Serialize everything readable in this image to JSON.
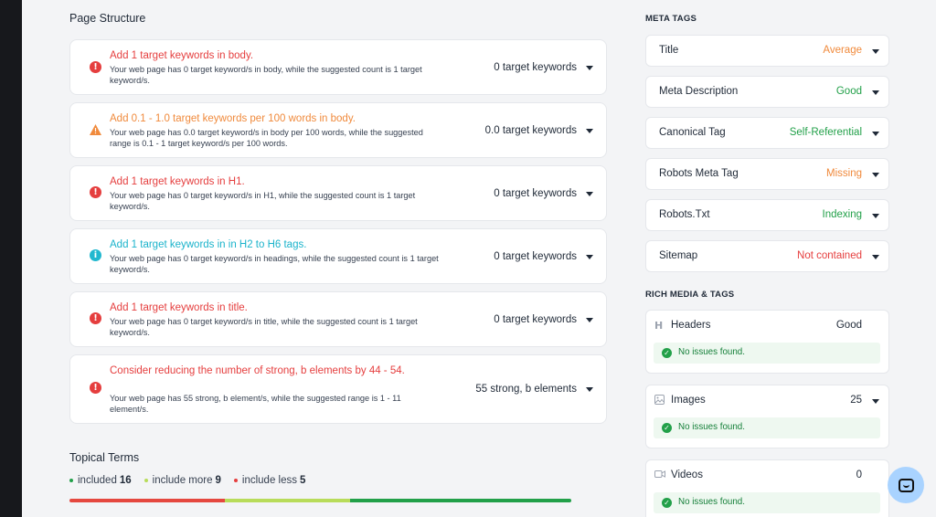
{
  "page_structure": {
    "heading": "Page Structure",
    "items": [
      {
        "title": "Add 1 target keywords in body.",
        "desc": "Your web page has 0 target keyword/s in body, while the suggested count is 1 target keyword/s.",
        "count": "0 target keywords",
        "status": "error",
        "color": "#e53e3e"
      },
      {
        "title": "Add 0.1 - 1.0 target keywords per 100 words in body.",
        "desc": "Your web page has 0.0 target keyword/s in body per 100 words, while the suggested range is 0.1 - 1 target keyword/s per 100 words.",
        "count": "0.0 target keywords",
        "status": "warning",
        "color": "#f08a3c"
      },
      {
        "title": "Add 1 target keywords in H1.",
        "desc": "Your web page has 0 target keyword/s in H1, while the suggested count is 1 target keyword/s.",
        "count": "0 target keywords",
        "status": "error",
        "color": "#e53e3e"
      },
      {
        "title": "Add 1 target keywords in in H2 to H6 tags.",
        "desc": "Your web page has 0 target keyword/s in headings, while the suggested count is 1 target keyword/s.",
        "count": "0 target keywords",
        "status": "info",
        "color": "#1ab3cb"
      },
      {
        "title": "Add 1 target keywords in title.",
        "desc": "Your web page has 0 target keyword/s in title, while the suggested count is 1 target keyword/s.",
        "count": "0 target keywords",
        "status": "error",
        "color": "#e53e3e"
      },
      {
        "title": "Consider reducing the number of strong, b elements by 44 - 54.",
        "desc": "Your web page has 55 strong, b element/s, while the suggested range is 1 - 11 element/s.",
        "count": "55 strong, b elements",
        "status": "error",
        "color": "#e53e3e"
      }
    ]
  },
  "topical_terms": {
    "heading": "Topical Terms",
    "legend": [
      {
        "label": "included",
        "count": "16",
        "color": "#22a049"
      },
      {
        "label": "include more",
        "count": "9",
        "color": "#b8dc5a"
      },
      {
        "label": "include less",
        "count": "5",
        "color": "#e53e3e"
      }
    ],
    "bar_segments": [
      {
        "name": "include less",
        "fraction": 0.31,
        "color": "#e5483f"
      },
      {
        "name": "include more",
        "fraction": 0.25,
        "color": "#b8dc5a"
      },
      {
        "name": "included",
        "fraction": 0.44,
        "color": "#22a049"
      }
    ]
  },
  "meta_tags": {
    "heading": "META TAGS",
    "items": [
      {
        "label": "Title",
        "value": "Average",
        "color": "#f08a3c"
      },
      {
        "label": "Meta Description",
        "value": "Good",
        "color": "#22a049"
      },
      {
        "label": "Canonical Tag",
        "value": "Self-Referential",
        "color": "#22a049"
      },
      {
        "label": "Robots Meta Tag",
        "value": "Missing",
        "color": "#f08a3c"
      },
      {
        "label": "Robots.Txt",
        "value": "Indexing",
        "color": "#22a049"
      },
      {
        "label": "Sitemap",
        "value": "Not contained",
        "color": "#e53e3e"
      }
    ]
  },
  "rich_media": {
    "heading": "RICH MEDIA & TAGS",
    "items": [
      {
        "label": "Headers",
        "value": "Good",
        "icon": "header-icon",
        "status": "No issues found."
      },
      {
        "label": "Images",
        "value": "25",
        "icon": "image-icon",
        "status": "No issues found."
      },
      {
        "label": "Videos",
        "value": "0",
        "icon": "video-icon",
        "status": "No issues found."
      }
    ]
  }
}
